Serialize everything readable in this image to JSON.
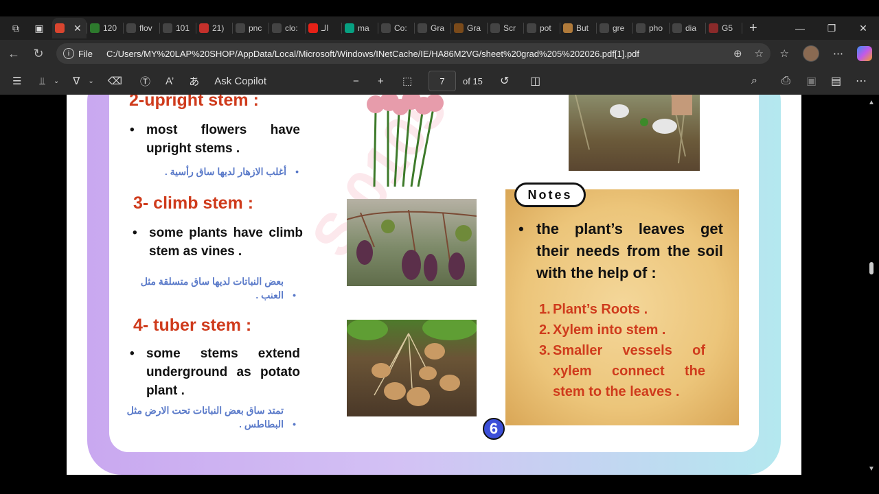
{
  "browser": {
    "tabs": [
      {
        "label": "",
        "active": true,
        "fav": "pdf-icon",
        "color": "#d9452f"
      },
      {
        "label": "120",
        "fav": "leaf-icon",
        "color": "#2d7a2d"
      },
      {
        "label": "flov",
        "fav": "wordpress-icon",
        "color": "#444"
      },
      {
        "label": "101",
        "fav": "globe-icon",
        "color": "#444"
      },
      {
        "label": "21)",
        "fav": "youtube-icon",
        "color": "#c4302b"
      },
      {
        "label": "pnc",
        "fav": "globe-icon",
        "color": "#444"
      },
      {
        "label": "clo:",
        "fav": "globe-icon",
        "color": "#444"
      },
      {
        "label": "الـ",
        "fav": "youtube-icon",
        "color": "#e62117"
      },
      {
        "label": "ma",
        "fav": "pexels-icon",
        "color": "#07a081"
      },
      {
        "label": "Co:",
        "fav": "globe-icon",
        "color": "#444"
      },
      {
        "label": "Gra",
        "fav": "globe-icon",
        "color": "#444"
      },
      {
        "label": "Gra",
        "fav": "flame-icon",
        "color": "#7a4a1a"
      },
      {
        "label": "Scr",
        "fav": "globe-icon",
        "color": "#444"
      },
      {
        "label": "pot",
        "fav": "globe-icon",
        "color": "#444"
      },
      {
        "label": "But",
        "fav": "butter-icon",
        "color": "#b07a3a"
      },
      {
        "label": "gre",
        "fav": "globe-icon",
        "color": "#444"
      },
      {
        "label": "pho",
        "fav": "globe-icon",
        "color": "#444"
      },
      {
        "label": "dia",
        "fav": "globe-icon",
        "color": "#444"
      },
      {
        "label": "G5",
        "fav": "pdf-icon",
        "color": "#8a2a2a"
      }
    ],
    "url_file_label": "File",
    "url": "C:/Users/MY%20LAP%20SHOP/AppData/Local/Microsoft/Windows/INetCache/IE/HA86M2VG/sheet%20grad%205%202026.pdf[1].pdf"
  },
  "pdf_toolbar": {
    "ask_copilot": "Ask Copilot",
    "page_current": "7",
    "page_total": "of 15"
  },
  "content": {
    "upright": {
      "heading": "2-upright stem :",
      "text": "most flowers have upright stems .",
      "arabic": "أغلب الازهار لديها ساق رأسية ."
    },
    "climb": {
      "heading": "3- climb stem :",
      "text": "some plants have climb stem as vines .",
      "arabic": "بعض النباتات لديها ساق متسلقة مثل العنب ."
    },
    "tuber": {
      "heading": "4- tuber stem :",
      "text": "some stems extend underground as potato plant .",
      "arabic": "تمتد ساق بعض النباتات تحت الارض مثل البطاطس ."
    },
    "notes": {
      "tag": "Notes",
      "main": "the plant’s leaves get their needs from the soil with the help of :",
      "items": [
        {
          "num": "1.",
          "text": "Plant’s  Roots ."
        },
        {
          "num": "2.",
          "text": "Xylem into stem ."
        },
        {
          "num": "3.",
          "text": "Smaller vessels of xylem connect the stem to the leaves ."
        }
      ]
    },
    "page_number": "6"
  }
}
